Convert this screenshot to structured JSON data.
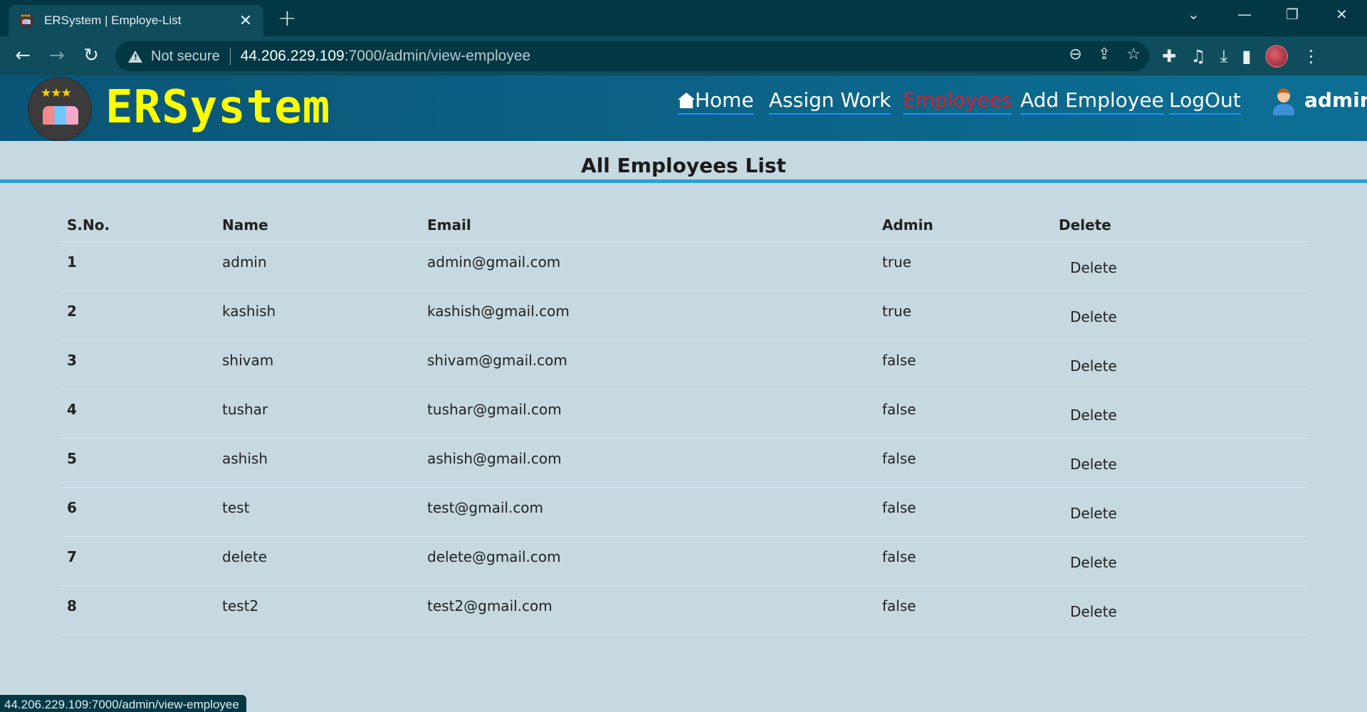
{
  "browser": {
    "tab_title": "ERSystem | Employe-List",
    "not_secure": "Not secure",
    "url_host": "44.206.229.109",
    "url_path": ":7000/admin/view-employee",
    "status_url": "44.206.229.109:7000/admin/view-employee"
  },
  "header": {
    "brand": "ERSystem",
    "nav": [
      {
        "label": "Home",
        "active": false
      },
      {
        "label": "Assign Work",
        "active": false
      },
      {
        "label": "Employees",
        "active": true
      },
      {
        "label": "Add Employee",
        "active": false
      },
      {
        "label": "LogOut",
        "active": false
      }
    ],
    "user": "admin"
  },
  "page": {
    "title": "All Employees List",
    "columns": [
      "S.No.",
      "Name",
      "Email",
      "Admin",
      "Delete"
    ],
    "rows": [
      {
        "sno": "1",
        "name": "admin",
        "email": "admin@gmail.com",
        "admin": "true",
        "action": "Delete"
      },
      {
        "sno": "2",
        "name": "kashish",
        "email": "kashish@gmail.com",
        "admin": "true",
        "action": "Delete"
      },
      {
        "sno": "3",
        "name": "shivam",
        "email": "shivam@gmail.com",
        "admin": "false",
        "action": "Delete"
      },
      {
        "sno": "4",
        "name": "tushar",
        "email": "tushar@gmail.com",
        "admin": "false",
        "action": "Delete"
      },
      {
        "sno": "5",
        "name": "ashish",
        "email": "ashish@gmail.com",
        "admin": "false",
        "action": "Delete"
      },
      {
        "sno": "6",
        "name": "test",
        "email": "test@gmail.com",
        "admin": "false",
        "action": "Delete"
      },
      {
        "sno": "7",
        "name": "delete",
        "email": "delete@gmail.com",
        "admin": "false",
        "action": "Delete"
      },
      {
        "sno": "8",
        "name": "test2",
        "email": "test2@gmail.com",
        "admin": "false",
        "action": "Delete"
      }
    ]
  },
  "colors": {
    "brand_yellow": "#ffff00",
    "active_nav": "#dd1c2c",
    "header_bg": "#0d6f95",
    "page_bg": "#c6d8e0",
    "title_rule": "#24a0da"
  }
}
